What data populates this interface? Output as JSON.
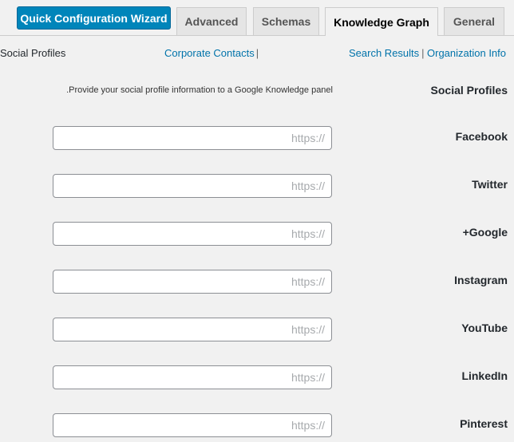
{
  "header": {
    "wizard_label": "Quick Configuration Wizard",
    "tabs": [
      {
        "label": "Advanced"
      },
      {
        "label": "Schemas"
      },
      {
        "label": "Knowledge Graph"
      },
      {
        "label": "General"
      }
    ],
    "active_tab": "Knowledge Graph"
  },
  "subnav": {
    "items": [
      {
        "label": "Corporate Contacts"
      },
      {
        "label": "Social Profiles"
      },
      {
        "label": "Search Results"
      },
      {
        "label": "Organization Info"
      }
    ],
    "separator": "|",
    "active": "Social Profiles"
  },
  "section": {
    "title": "Social Profiles",
    "description": ".Provide your social profile information to a Google Knowledge panel"
  },
  "fields": [
    {
      "label": "Facebook",
      "placeholder": "//:https",
      "value": ""
    },
    {
      "label": "Twitter",
      "placeholder": "//:https",
      "value": ""
    },
    {
      "label": "+Google",
      "placeholder": "//:https",
      "value": ""
    },
    {
      "label": "Instagram",
      "placeholder": "//:https",
      "value": ""
    },
    {
      "label": "YouTube",
      "placeholder": "//:https",
      "value": ""
    },
    {
      "label": "LinkedIn",
      "placeholder": "//:https",
      "value": ""
    },
    {
      "label": "Pinterest",
      "placeholder": "//:https",
      "value": ""
    }
  ]
}
